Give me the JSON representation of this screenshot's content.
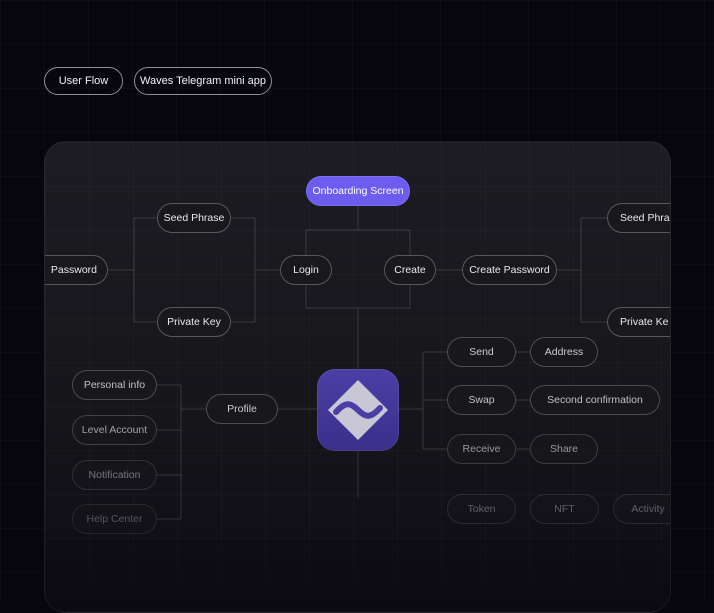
{
  "tags": [
    "User Flow",
    "Waves Telegram mini app"
  ],
  "nodes": {
    "onboarding": "Onboarding Screen",
    "password": "Password",
    "seed_phrase_left": "Seed Phrase",
    "private_key_left": "Private Key",
    "login": "Login",
    "create": "Create",
    "create_password": "Create Password",
    "seed_phrase_right": "Seed Phra",
    "private_key_right": "Private Ke",
    "send": "Send",
    "address": "Address",
    "swap": "Swap",
    "second_confirmation": "Second confirmation",
    "receive": "Receive",
    "share": "Share",
    "personal_info": "Personal info",
    "level_account": "Level Account",
    "notification": "Notification",
    "help_center": "Help Center",
    "profile": "Profile",
    "token": "Token",
    "nft": "NFT",
    "activity": "Activity"
  },
  "colors": {
    "background": "#07060f",
    "panel": "#1c1c22",
    "accent": "#6c5cf0",
    "logo": "#4b3fa6"
  },
  "logo_icon": "waves-logo-icon"
}
